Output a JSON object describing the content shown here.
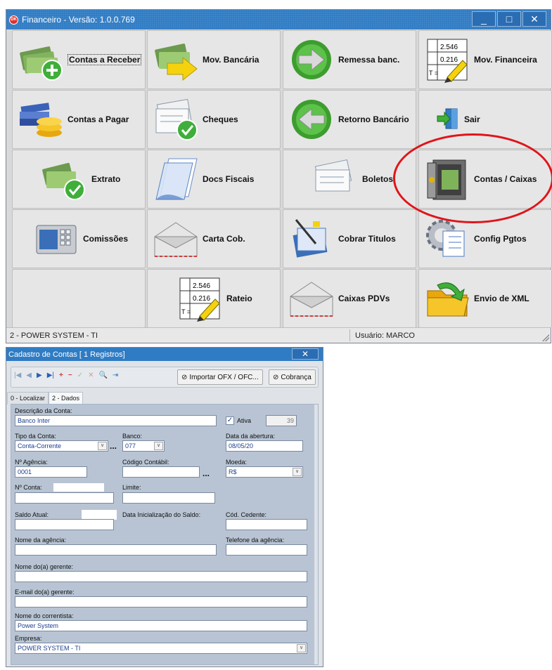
{
  "main_window": {
    "title": "Financeiro - Versão: 1.0.0.769",
    "app_icon_text": "DK",
    "controls": {
      "minimize": "_",
      "maximize": "□",
      "close": "✕"
    }
  },
  "tiles": {
    "contas_receber": "Contas a Receber",
    "mov_bancaria": "Mov. Bancária",
    "remessa": "Remessa banc.",
    "mov_financeira": "Mov. Financeira",
    "contas_pagar": "Contas a Pagar",
    "cheques": "Cheques",
    "retorno": "Retorno Bancário",
    "sair": "Sair",
    "extrato": "Extrato",
    "docs_fiscais": "Docs Fiscais",
    "boletos": "Boletos",
    "contas_caixas": "Contas / Caixas",
    "comissoes": "Comissões",
    "carta_cob": "Carta Cob.",
    "cobrar_titulos": "Cobrar Titulos",
    "config_pgtos": "Config Pgtos",
    "rateio": "Rateio",
    "caixas_pdvs": "Caixas PDVs",
    "envio_xml": "Envio de XML"
  },
  "spreadsheet_icon": {
    "row1": "2.546",
    "row2": "0.216",
    "total_prefix": "T ="
  },
  "status": {
    "company": "2 - POWER SYSTEM - TI",
    "user": "Usuário: MARCO"
  },
  "cadastro": {
    "title": "Cadastro de Contas [ 1 Registros]",
    "close": "✕",
    "toolbar": {
      "import_label": "Importar OFX / OFC...",
      "cobranca_label": "Cobrança"
    },
    "tabs": [
      "0 - Localizar",
      "2 - Dados"
    ],
    "fields": {
      "descricao_label": "Descrição da Conta:",
      "descricao_value": "Banco Inter",
      "ativa_label": "Ativa",
      "ativa_checked": "✓",
      "ativa_code": "39",
      "tipo_label": "Tipo da Conta:",
      "tipo_value": "Conta-Corrente",
      "banco_label": "Banco:",
      "banco_value": "077",
      "data_abertura_label": "Data da abertura:",
      "data_abertura_value": "08/05/20",
      "agencia_label": "Nº Agência:",
      "agencia_value": "0001",
      "codigo_contabil_label": "Código Contábil:",
      "moeda_label": "Moeda:",
      "moeda_value": "R$",
      "conta_label": "Nº Conta:",
      "limite_label": "Limite:",
      "saldo_label": "Saldo Atual:",
      "data_init_label": "Data Inicialização do Saldo:",
      "cod_cedente_label": "Cód. Cedente:",
      "nome_agencia_label": "Nome da agência:",
      "telefone_label": "Telefone da agência:",
      "gerente_label": "Nome do(a) gerente:",
      "email_label": "E-mail do(a) gerente:",
      "correntista_label": "Nome do correntista:",
      "correntista_value": "Power System",
      "empresa_label": "Empresa:",
      "empresa_value": "POWER SYSTEM - TI"
    }
  }
}
